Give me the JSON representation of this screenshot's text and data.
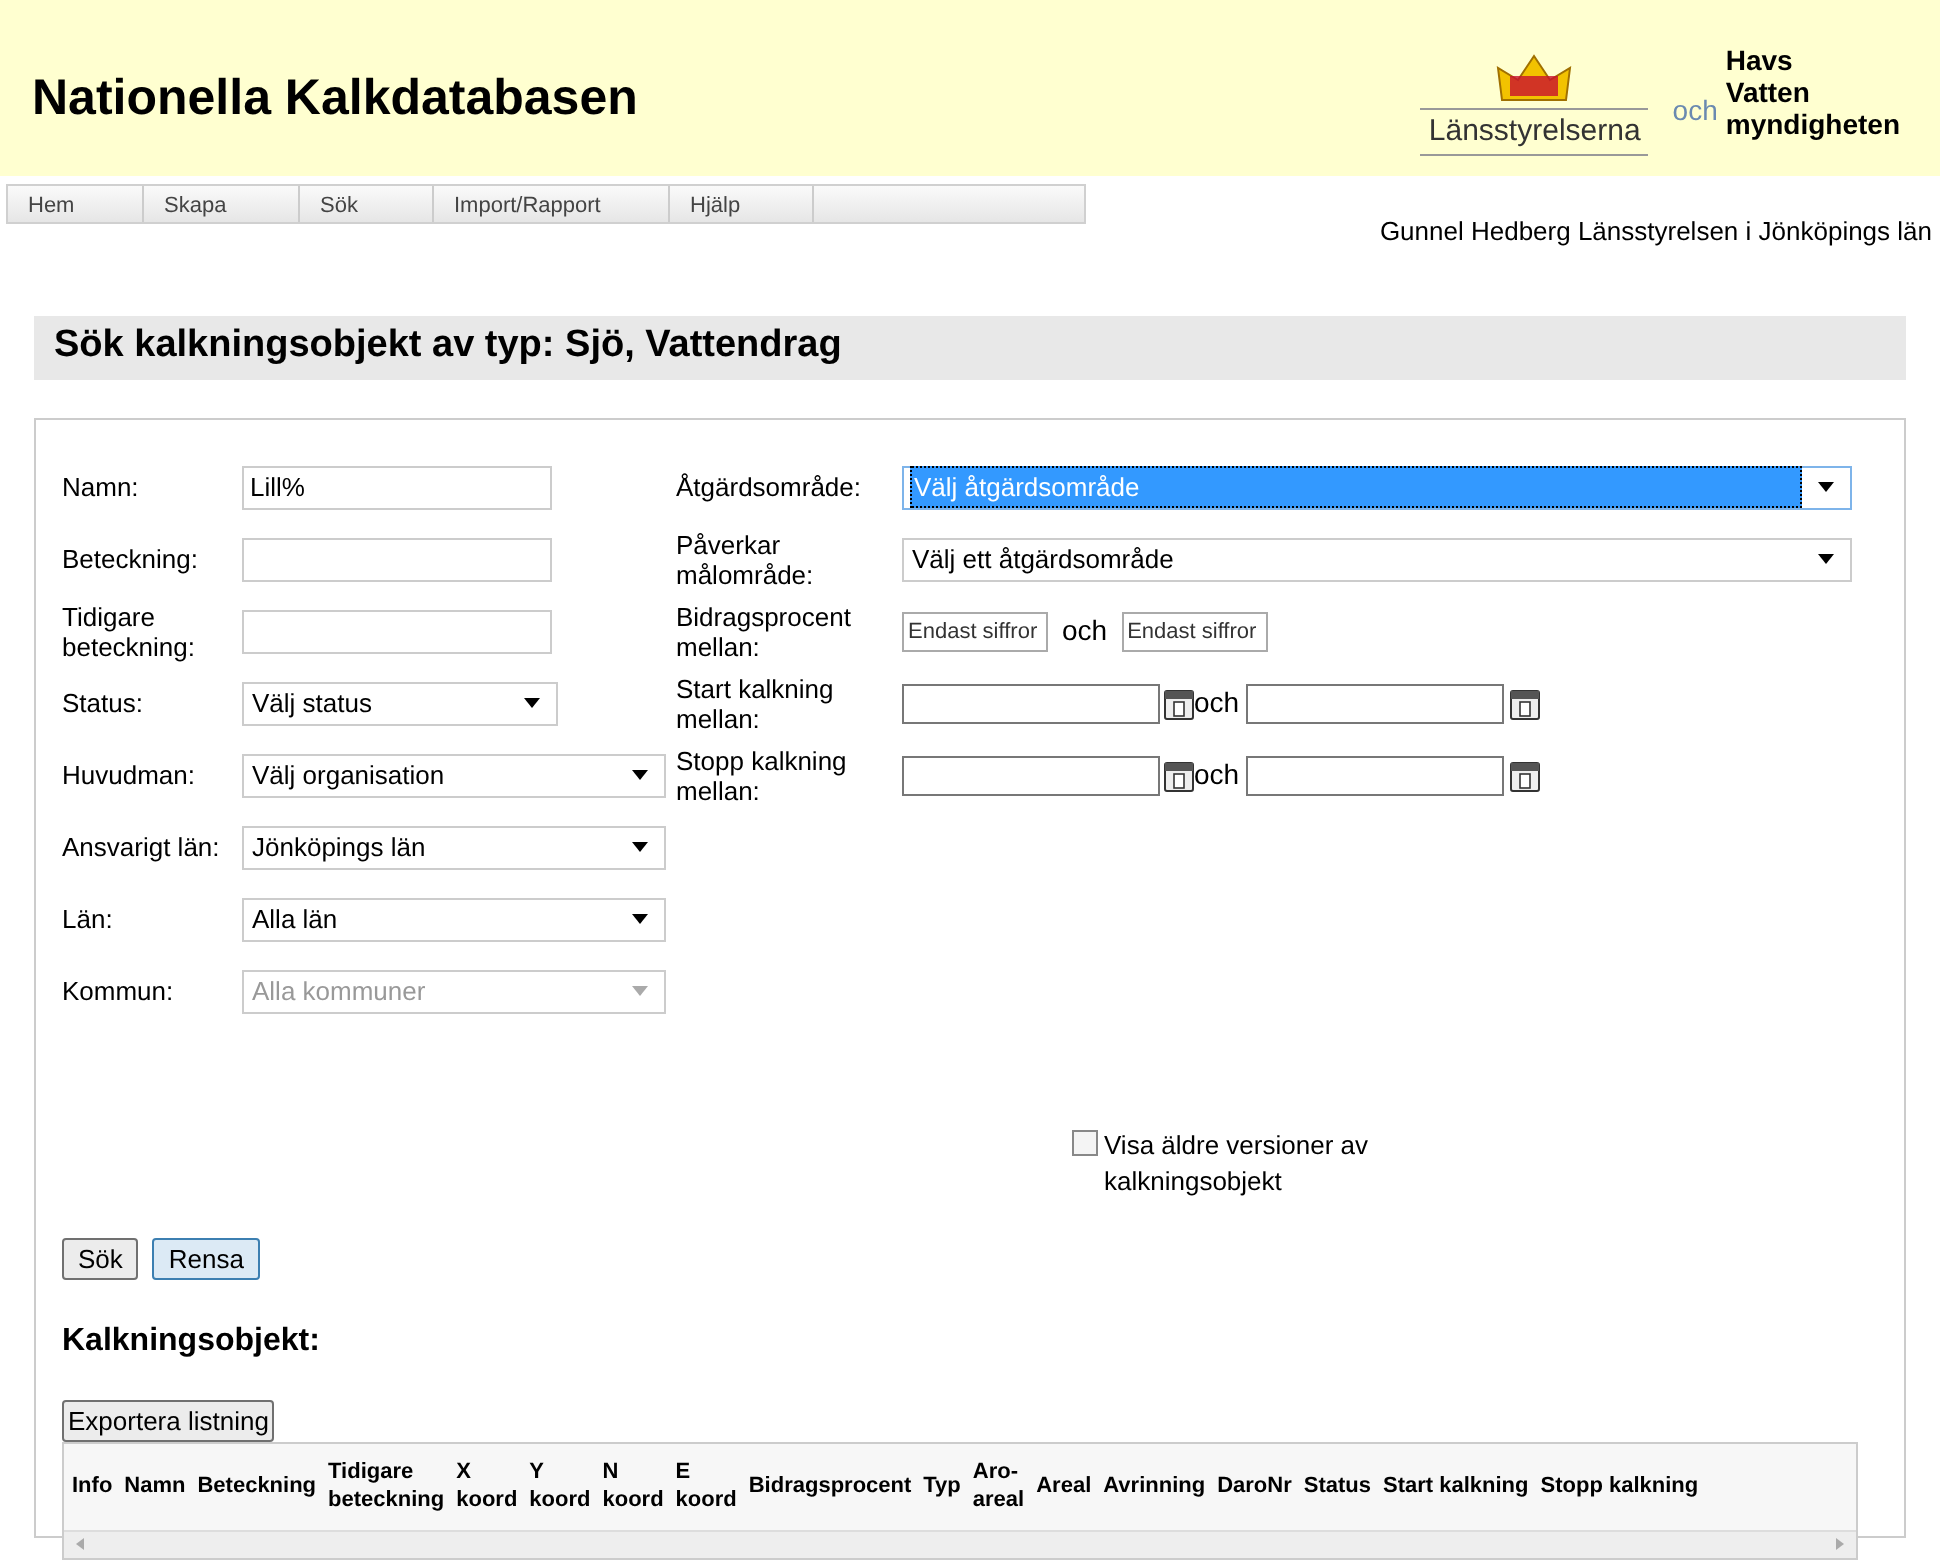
{
  "header": {
    "title": "Nationella Kalkdatabasen",
    "logo_left": "Länsstyrelserna",
    "logo_och": "och",
    "logo_right": [
      "Havs",
      "Vatten",
      "myndigheten"
    ]
  },
  "menu": [
    {
      "label": "Hem"
    },
    {
      "label": "Skapa"
    },
    {
      "label": "Sök"
    },
    {
      "label": "Import/Rapport"
    },
    {
      "label": "Hjälp"
    }
  ],
  "user": "Gunnel Hedberg Länsstyrelsen i Jönköpings län",
  "page_title": "Sök kalkningsobjekt av typ: Sjö, Vattendrag",
  "left_fields": [
    {
      "label": "Namn:",
      "kind": "text",
      "value": "Lill%"
    },
    {
      "label": "Beteckning:",
      "kind": "text"
    },
    {
      "label": "Tidigare beteckning:",
      "kind": "text"
    },
    {
      "label": "Status:",
      "kind": "short_select",
      "value": "Välj status",
      "disabled": false
    },
    {
      "label": "Huvudman:",
      "kind": "select",
      "value": "Välj organisation",
      "disabled": false
    },
    {
      "label": "Ansvarigt län:",
      "kind": "select",
      "value": "Jönköpings län",
      "disabled": false
    },
    {
      "label": "Län:",
      "kind": "select",
      "value": "Alla län",
      "disabled": false
    },
    {
      "label": "Kommun:",
      "kind": "select",
      "value": "Alla kommuner",
      "disabled": true
    }
  ],
  "right_fields": [
    {
      "label": "Åtgärdsområde:",
      "kind": "select",
      "value": "Välj åtgärdsområde",
      "focused": true
    },
    {
      "label": "Påverkar målområde:",
      "kind": "select",
      "value": "Välj ett åtgärdsområde",
      "focused": false
    },
    {
      "label": "Bidragsprocent mellan:",
      "kind": "range",
      "placeholders": [
        "Endast siffror",
        "Endast siffror"
      ],
      "joiner": "och"
    },
    {
      "label": "Start kalkning mellan:",
      "kind": "date_range",
      "joiner": "och"
    },
    {
      "label": "Stopp kalkning mellan:",
      "kind": "date_range",
      "joiner": "och"
    }
  ],
  "older_versions": {
    "label": "Visa äldre versioner av kalkningsobjekt",
    "checked": false
  },
  "buttons": [
    {
      "label": "Sök",
      "focused": false
    },
    {
      "label": "Rensa",
      "focused": true
    }
  ],
  "results_title": "Kalkningsobjekt:",
  "export_button": "Exportera listning",
  "table": {
    "columns": [
      "Info",
      "Namn",
      "Beteckning",
      "Tidigare\nbeteckning",
      "X\nkoord",
      "Y\nkoord",
      "N\nkoord",
      "E\nkoord",
      "Bidragsprocent",
      "Typ",
      "Aro-\nareal",
      "Areal",
      "Avrinning",
      "DaroNr",
      "Status",
      "Start kalkning",
      "Stopp kalkning"
    ]
  }
}
